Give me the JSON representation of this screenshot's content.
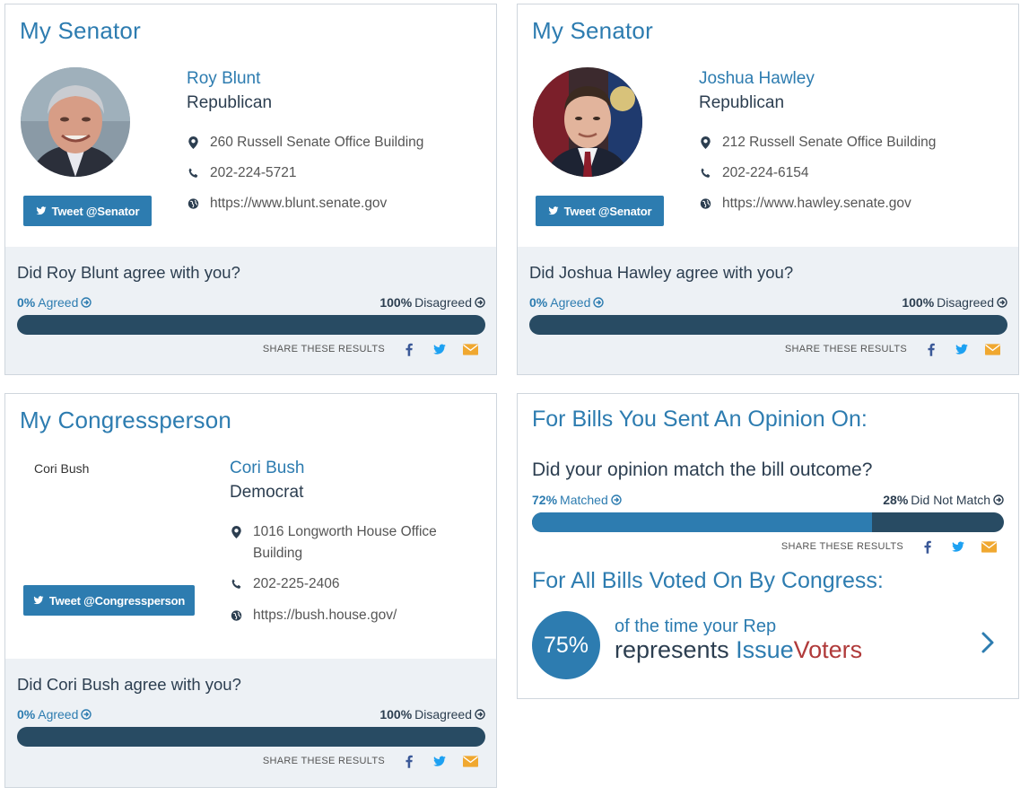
{
  "senator1": {
    "section_title": "My Senator",
    "name": "Roy Blunt",
    "party": "Republican",
    "address": "260 Russell Senate Office Building",
    "phone": "202-224-5721",
    "website": "https://www.blunt.senate.gov",
    "tweet_label": "Tweet @Senator",
    "question": "Did Roy Blunt agree with you?",
    "agreed_pct": "0%",
    "agreed_label": "Agreed",
    "disagreed_pct": "100%",
    "disagreed_label": "Disagreed",
    "agreed_fraction": 0.0,
    "share_label": "SHARE THESE RESULTS"
  },
  "senator2": {
    "section_title": "My Senator",
    "name": "Joshua Hawley",
    "party": "Republican",
    "address": "212 Russell Senate Office Building",
    "phone": "202-224-6154",
    "website": "https://www.hawley.senate.gov",
    "tweet_label": "Tweet @Senator",
    "question": "Did Joshua Hawley agree with you?",
    "agreed_pct": "0%",
    "agreed_label": "Agreed",
    "disagreed_pct": "100%",
    "disagreed_label": "Disagreed",
    "agreed_fraction": 0.0,
    "share_label": "SHARE THESE RESULTS"
  },
  "congressperson": {
    "section_title": "My Congressperson",
    "photo_alt": "Cori Bush",
    "name": "Cori Bush",
    "party": "Democrat",
    "address_line1": "1016 Longworth House Office",
    "address_line2": "Building",
    "phone": "202-225-2406",
    "website": "https://bush.house.gov/",
    "tweet_label": "Tweet @Congressperson",
    "question": "Did Cori Bush agree with you?",
    "agreed_pct": "0%",
    "agreed_label": "Agreed",
    "disagreed_pct": "100%",
    "disagreed_label": "Disagreed",
    "agreed_fraction": 0.0,
    "share_label": "SHARE THESE RESULTS"
  },
  "bills": {
    "title": "For Bills You Sent An Opinion On:",
    "question": "Did your opinion match the bill outcome?",
    "matched_pct": "72%",
    "matched_label": "Matched",
    "not_matched_pct": "28%",
    "not_matched_label": "Did Not Match",
    "matched_fraction": 0.72,
    "share_label": "SHARE THESE RESULTS",
    "congress_title": "For All Bills Voted On By Congress:",
    "represents_pct": "75%",
    "line1": "of the time your Rep",
    "line2_prefix": "represents ",
    "brand_issue": "Issue",
    "brand_voters": "Voters"
  },
  "colors": {
    "accent": "#2d7cb0",
    "bar_dark": "#284b63",
    "panel_bg": "#edf1f5",
    "facebook": "#3b5998",
    "twitter": "#1da1f2",
    "email": "#f0a830",
    "brand_red": "#b03a3a"
  },
  "icons": {
    "location": "map-marker-icon",
    "phone": "phone-icon",
    "website": "globe-icon",
    "tweet": "twitter-bird-icon",
    "facebook": "facebook-icon",
    "twitter": "twitter-icon",
    "email": "envelope-icon",
    "stat": "circle-arrow-right-icon",
    "chevron": "chevron-right-icon"
  }
}
